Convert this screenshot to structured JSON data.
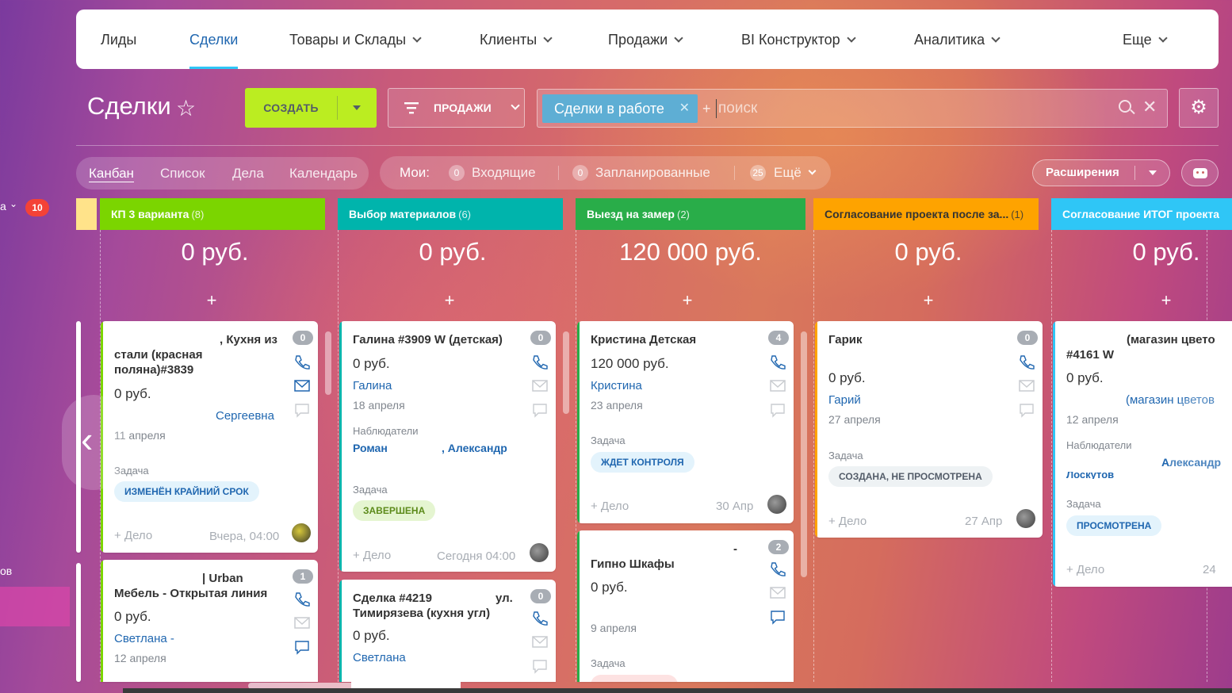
{
  "sidebar": {
    "frag_a": "a",
    "badge": "10",
    "frag_b": "ов"
  },
  "nav": {
    "items": [
      {
        "label": "Лиды"
      },
      {
        "label": "Сделки"
      },
      {
        "label": "Товары и Склады"
      },
      {
        "label": "Клиенты"
      },
      {
        "label": "Продажи"
      },
      {
        "label": "BI Конструктор"
      },
      {
        "label": "Аналитика"
      },
      {
        "label": "Еще"
      }
    ]
  },
  "header": {
    "title": "Сделки",
    "create_label": "СОЗДАТЬ",
    "funnel_label": "ПРОДАЖИ",
    "filter_chip": "Сделки в работе",
    "search_plus": "+",
    "search_placeholder": "поиск"
  },
  "views": {
    "kanban": "Канбан",
    "list": "Список",
    "activities": "Дела",
    "calendar": "Календарь"
  },
  "mine": {
    "label": "Мои:",
    "incoming_count": "0",
    "incoming": "Входящие",
    "planned_count": "0",
    "planned": "Запланированные",
    "more_count": "25",
    "more": "Ещё"
  },
  "extensions_label": "Расширения",
  "columns": [
    {
      "title": "КП 3 варианта",
      "count": "(8)",
      "sum": "0 руб.",
      "add": "+",
      "color": "#7bd500"
    },
    {
      "title": "Выбор материалов",
      "count": "(6)",
      "sum": "0 руб.",
      "add": "+",
      "color": "#00b4ac"
    },
    {
      "title": "Выезд на замер",
      "count": "(2)",
      "sum": "120 000 руб.",
      "add": "+",
      "color": "#29ad49"
    },
    {
      "title": "Согласование проекта после за...",
      "count": "(1)",
      "sum": "0 руб.",
      "add": "+",
      "color": "#fea300"
    },
    {
      "title": "Согласование ИТОГ проекта",
      "count": "",
      "sum": "0 руб.",
      "add": "+",
      "color": "#2fc6f6"
    }
  ],
  "cards": {
    "c1": {
      "title_a": ", Кухня из",
      "title_b": "стали (красная поляна)#3839",
      "price": "0 руб.",
      "contact": "Сергеевна",
      "date": "11 апреля",
      "task_label": "Задача",
      "task": "ИЗМЕНЁН КРАЙНИЙ СРОК",
      "add": "+ Дело",
      "when": "Вчера, 04:00",
      "badge": "0"
    },
    "c2": {
      "title_a": "| Urban",
      "title_b": "Мебель - Открытая линия",
      "price": "0 руб.",
      "contact": "Светлана -",
      "date": "12 апреля",
      "badge": "1"
    },
    "c3": {
      "title": "Галина #3909 W (детская)",
      "price": "0 руб.",
      "contact": "Галина",
      "date": "18 апреля",
      "watchers_label": "Наблюдатели",
      "watcher1": "Роман",
      "watcher2": ", Александр",
      "task_label": "Задача",
      "task": "ЗАВЕРШЕНА",
      "add": "+ Дело",
      "when": "Сегодня 04:00",
      "badge": "0"
    },
    "c4": {
      "title_a": "Сделка #4219",
      "title_b": "ул.",
      "title_c": "Тимирязева (кухня угл)",
      "price": "0 руб.",
      "contact": "Светлана",
      "badge": "0"
    },
    "c5": {
      "title": "Кристина Детская",
      "price": "120 000 руб.",
      "contact": "Кристина",
      "date": "23 апреля",
      "task_label": "Задача",
      "task": "ЖДЕТ КОНТРОЛЯ",
      "add": "+ Дело",
      "when": "30 Апр",
      "badge": "4"
    },
    "c6": {
      "title_a": "-",
      "title_b": "Гипно Шкафы",
      "price": "0 руб.",
      "date": "9 апреля",
      "task_label": "Задача",
      "badge": "2"
    },
    "c7": {
      "title": "Гарик",
      "price": "0 руб.",
      "contact": "Гарий",
      "date": "27 апреля",
      "task_label": "Задача",
      "task": "СОЗДАНА, НЕ ПРОСМОТРЕНА",
      "add": "+ Дело",
      "when": "27 Апр",
      "badge": "0"
    },
    "c8": {
      "title_a": "(магазин цвето",
      "title_b": "#4161 W",
      "price": "0 руб.",
      "contact": "(магазин цветов",
      "date": "12 апреля",
      "watchers_label": "Наблюдатели",
      "watcher": "Александр",
      "watcher_b": "Лоскутов",
      "task_label": "Задача",
      "task": "ПРОСМОТРЕНА",
      "add": "+ Дело",
      "when": "24"
    }
  },
  "colors": {
    "accent_blue": "#2067b0",
    "create_green": "#bbed21",
    "badge_red": "#f44236",
    "chip_blue": "#5eaed4"
  }
}
